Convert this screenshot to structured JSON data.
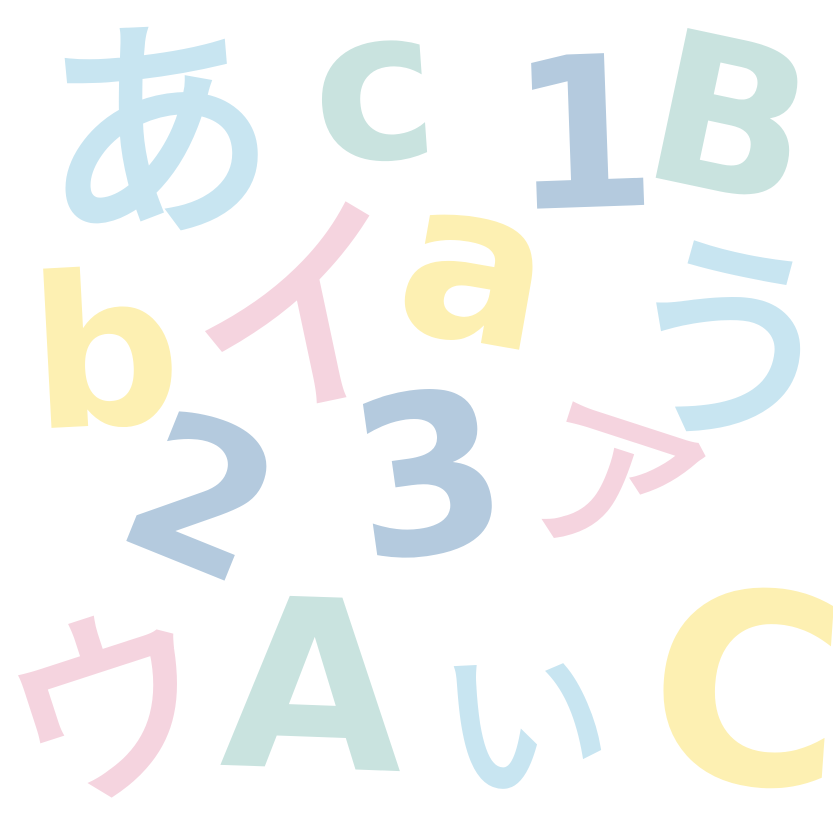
{
  "background": "#ffffff",
  "palette": {
    "light_blue": "#c8e5f1",
    "mint": "#c9e3df",
    "steel_blue": "#b4cade",
    "yellow": "#fdf0b2",
    "pink": "#f5d4df"
  },
  "glyphs": {
    "hira_a": {
      "char": "あ",
      "color": "light_blue"
    },
    "c_small": {
      "char": "c",
      "color": "mint"
    },
    "one": {
      "char": "1",
      "color": "steel_blue"
    },
    "b_upper": {
      "char": "B",
      "color": "mint"
    },
    "b_lower": {
      "char": "b",
      "color": "yellow"
    },
    "kata_i": {
      "char": "イ",
      "color": "pink"
    },
    "a_lower": {
      "char": "a",
      "color": "yellow"
    },
    "hira_u": {
      "char": "う",
      "color": "light_blue"
    },
    "two": {
      "char": "2",
      "color": "steel_blue"
    },
    "three": {
      "char": "3",
      "color": "steel_blue"
    },
    "kata_a": {
      "char": "ア",
      "color": "pink"
    },
    "kata_u": {
      "char": "ウ",
      "color": "pink"
    },
    "a_upper": {
      "char": "A",
      "color": "mint"
    },
    "hira_i": {
      "char": "い",
      "color": "light_blue"
    },
    "c_big": {
      "char": "C",
      "color": "yellow"
    }
  }
}
